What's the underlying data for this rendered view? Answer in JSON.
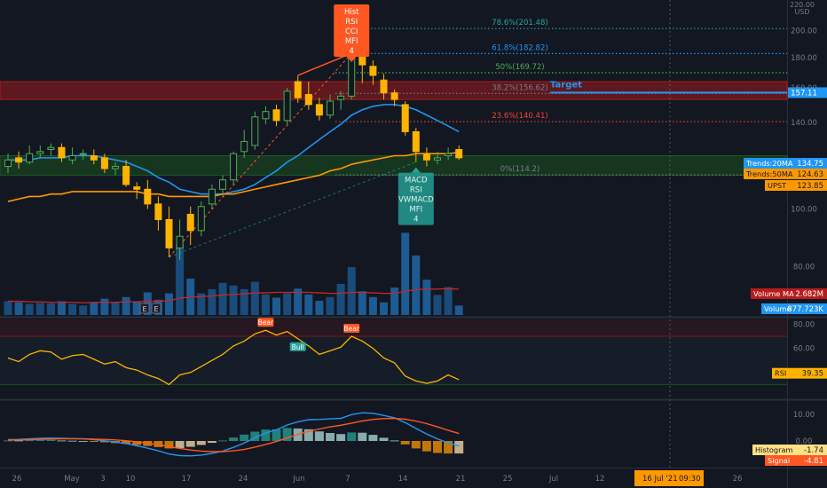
{
  "chart_data": {
    "type": "candlestick",
    "symbol": "UPST",
    "currency": "USD",
    "price_axis": {
      "unit": "USD",
      "top_label": "220.00",
      "ticks": [
        "200.00",
        "180.00",
        "160.00",
        "140.00",
        "120.00",
        "100.00",
        "80.00"
      ],
      "ylim": [
        60,
        222
      ],
      "scale": "log"
    },
    "date_axis": {
      "ticks": [
        "26",
        "May",
        "3",
        "10",
        "17",
        "24",
        "Jun",
        "7",
        "14",
        "21",
        "25",
        "Jul",
        "12",
        "19",
        "26"
      ],
      "cursor_label": "16 Jul '21",
      "cursor_time": "09:30"
    },
    "candles": {
      "x": [
        "Apr 21",
        "Apr 22",
        "Apr 23",
        "Apr 26",
        "Apr 27",
        "Apr 28",
        "Apr 29",
        "Apr 30",
        "May 3",
        "May 4",
        "May 5",
        "May 6",
        "May 7",
        "May 10",
        "May 11",
        "May 12",
        "May 13",
        "May 14",
        "May 17",
        "May 18",
        "May 19",
        "May 20",
        "May 21",
        "May 24",
        "May 25",
        "May 26",
        "May 27",
        "May 28",
        "Jun 1",
        "Jun 2",
        "Jun 3",
        "Jun 4",
        "Jun 7",
        "Jun 8",
        "Jun 9",
        "Jun 10",
        "Jun 11",
        "Jun 14",
        "Jun 15",
        "Jun 16",
        "Jun 17",
        "Jun 18",
        "Jun 21"
      ],
      "open": [
        118,
        122,
        120,
        124,
        126,
        127,
        121,
        124,
        123,
        122,
        117,
        118,
        109,
        108,
        102,
        96,
        86,
        98,
        92,
        102,
        108,
        112,
        125,
        128,
        142,
        147,
        141,
        164,
        156,
        150,
        144,
        153,
        155,
        183,
        174,
        165,
        157,
        150,
        135,
        124,
        121,
        123,
        126
      ],
      "high": [
        124,
        125,
        128,
        128,
        129,
        129,
        127,
        126,
        126,
        124,
        120,
        121,
        111,
        112,
        105,
        101,
        96,
        101,
        103,
        110,
        114,
        125,
        136,
        146,
        149,
        150,
        160,
        168,
        164,
        154,
        156,
        158,
        183,
        184,
        178,
        169,
        159,
        152,
        137,
        127,
        125,
        127,
        128
      ],
      "low": [
        115,
        117,
        119,
        122,
        123,
        120,
        119,
        121,
        119,
        115,
        114,
        109,
        104,
        100,
        92,
        83,
        82,
        87,
        90,
        100,
        105,
        110,
        122,
        126,
        139,
        138,
        139,
        151,
        147,
        141,
        142,
        147,
        153,
        163,
        162,
        153,
        149,
        133,
        120,
        118,
        119,
        121,
        121
      ],
      "close": [
        121,
        120,
        124,
        125,
        127,
        122,
        123,
        124,
        121,
        117,
        118,
        110,
        108,
        102,
        96,
        86,
        90,
        92,
        101,
        108,
        112,
        124,
        130,
        143,
        146,
        141,
        158,
        154,
        150,
        144,
        152,
        155,
        181,
        175,
        168,
        157,
        153,
        135,
        125,
        121,
        122,
        124,
        122
      ]
    },
    "volume": {
      "label": "Volume",
      "value": "877.723K",
      "values": [
        2.6,
        2.4,
        2.1,
        2.3,
        2.2,
        2.6,
        2.1,
        1.8,
        2.4,
        3.1,
        2.4,
        3.4,
        2.6,
        4.3,
        2.9,
        4.1,
        13.5,
        6.9,
        4.1,
        4.9,
        6.1,
        5.6,
        4.9,
        6.3,
        3.9,
        3.3,
        4.1,
        5.0,
        3.9,
        2.7,
        3.4,
        5.9,
        9.1,
        4.5,
        3.4,
        2.4,
        5.2,
        15.6,
        11.3,
        6.7,
        3.8,
        5.3,
        1.8
      ],
      "ma_label": "Volume MA",
      "ma_value": "2.682M",
      "ma_values": [
        2.6,
        2.6,
        2.5,
        2.5,
        2.4,
        2.4,
        2.4,
        2.3,
        2.4,
        2.4,
        2.4,
        2.5,
        2.5,
        2.6,
        2.6,
        2.7,
        3.2,
        3.4,
        3.5,
        3.6,
        3.8,
        3.9,
        4.0,
        4.2,
        4.2,
        4.3,
        4.3,
        4.3,
        4.3,
        4.2,
        4.1,
        4.1,
        4.3,
        4.3,
        4.2,
        4.1,
        4.1,
        4.5,
        4.8,
        4.9,
        4.9,
        5.0,
        4.9
      ]
    },
    "series": [
      {
        "name": "Trends:20MA",
        "value": "134.75",
        "color": "#2196f3",
        "values": [
          121,
          121,
          121,
          122,
          122,
          122,
          123,
          123,
          123,
          122,
          121,
          120,
          118,
          116,
          113,
          111,
          108,
          107,
          106,
          106,
          106,
          107,
          108,
          110,
          113,
          116,
          120,
          123,
          127,
          131,
          135,
          139,
          144,
          147,
          149,
          150,
          150,
          149,
          147,
          144,
          141,
          138,
          135
        ]
      },
      {
        "name": "Trends:50MA",
        "value": "124.63",
        "color": "#ff9800",
        "values": [
          103,
          104,
          105,
          105,
          106,
          106,
          107,
          107,
          107,
          107,
          107,
          107,
          107,
          106,
          106,
          105,
          105,
          105,
          105,
          105,
          106,
          106,
          107,
          108,
          109,
          110,
          111,
          112,
          113,
          114,
          116,
          117,
          119,
          120,
          121,
          122,
          123,
          123,
          124,
          124,
          124,
          124,
          124.6
        ]
      },
      {
        "name": "UPST",
        "value": "123.85",
        "color": "#ff9800"
      }
    ],
    "fibonacci": [
      {
        "label": "78.6%(201.48)",
        "level": 201.48,
        "color": "#26a69a"
      },
      {
        "label": "61.8%(182.82)",
        "level": 182.82,
        "color": "#2196f3"
      },
      {
        "label": "50%(169.72)",
        "level": 169.72,
        "color": "#4caf50"
      },
      {
        "label": "38.2%(156.62)",
        "level": 156.62,
        "color": "#787b86"
      },
      {
        "label": "23.6%(140.41)",
        "level": 140.41,
        "color": "#f44336"
      },
      {
        "label": "0%(114.2)",
        "level": 114.2,
        "color": "#787b86"
      }
    ],
    "target": {
      "label": "Target",
      "value": "157.11",
      "level": 157.11,
      "color": "#2196f3"
    },
    "zones": [
      {
        "from": 153,
        "to": 164,
        "color": "#b71c1c"
      },
      {
        "from": 114,
        "to": 123,
        "color": "#1b5e20"
      }
    ],
    "markers": [
      {
        "lines": [
          "Hist",
          "RSI",
          "CCI",
          "MFI",
          "4"
        ],
        "index": 32,
        "kind": "bearish-divergence",
        "color": "#ff5722"
      },
      {
        "lines": [
          "MACD",
          "RSI",
          "VWMACD",
          "MFI",
          "4"
        ],
        "index": 38,
        "kind": "bullish-divergence",
        "color": "#26a69a"
      }
    ],
    "earnings_markers": [
      "E",
      "E"
    ],
    "rsi": {
      "label": "RSI",
      "value": "39.35",
      "ticks": [
        "80.00",
        "60.00",
        "40.00"
      ],
      "ylim": [
        20,
        84
      ],
      "overbought": 70,
      "oversold": 30,
      "values": [
        52,
        49,
        55,
        58,
        57,
        51,
        54,
        55,
        51,
        47,
        49,
        44,
        42,
        38,
        35,
        30,
        38,
        40,
        45,
        50,
        55,
        62,
        66,
        72,
        75,
        71,
        74,
        68,
        62,
        55,
        58,
        61,
        70,
        66,
        60,
        52,
        48,
        37,
        33,
        31,
        33,
        38,
        34
      ],
      "signals": [
        {
          "label": "Bear",
          "index": 24
        },
        {
          "label": "Bull",
          "index": 27
        },
        {
          "label": "Bear",
          "index": 32
        }
      ]
    },
    "macd": {
      "histogram_label": "Histogram",
      "histogram_value": "-1.74",
      "signal_label": "Signal",
      "signal_value": "-4.81",
      "ticks": [
        "10.00",
        "0.00"
      ],
      "ylim": [
        -10,
        15
      ],
      "macd_values": [
        0.5,
        0.6,
        0.8,
        1.0,
        1.1,
        1.0,
        0.9,
        0.8,
        0.5,
        0.1,
        -0.4,
        -1.0,
        -1.8,
        -2.7,
        -3.7,
        -4.9,
        -5.5,
        -5.6,
        -5.3,
        -4.7,
        -3.8,
        -2.4,
        -0.8,
        1.2,
        3.0,
        4.2,
        6.0,
        7.2,
        8.0,
        8.1,
        8.3,
        8.5,
        9.9,
        10.6,
        10.4,
        9.6,
        8.7,
        6.9,
        4.7,
        2.6,
        0.8,
        -0.7,
        -1.9
      ],
      "signal_values": [
        0.3,
        0.4,
        0.5,
        0.6,
        0.7,
        0.8,
        0.8,
        0.8,
        0.7,
        0.6,
        0.4,
        0.1,
        -0.3,
        -0.8,
        -1.4,
        -2.1,
        -2.8,
        -3.4,
        -3.8,
        -4.0,
        -4.0,
        -3.7,
        -3.2,
        -2.3,
        -1.3,
        -0.2,
        1.1,
        2.5,
        3.6,
        4.5,
        5.3,
        5.9,
        6.7,
        7.5,
        8.1,
        8.4,
        8.5,
        8.2,
        7.5,
        6.5,
        5.3,
        4.0,
        2.8
      ]
    }
  }
}
